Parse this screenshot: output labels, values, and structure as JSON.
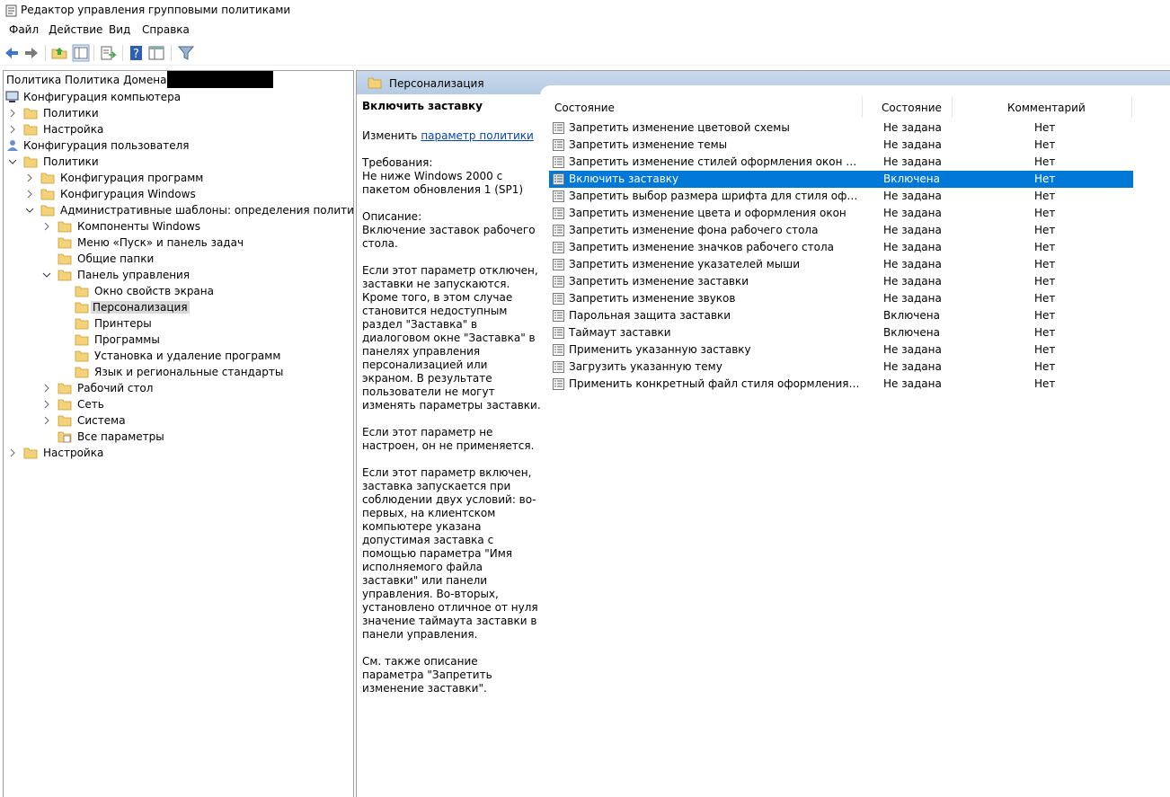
{
  "window": {
    "title": "Редактор управления групповыми политиками"
  },
  "menu": [
    "Файл",
    "Действие",
    "Вид",
    "Справка"
  ],
  "toolbar": {
    "buttons": [
      "back-arrow-icon",
      "forward-arrow-icon",
      "up-folder-icon",
      "show-hide-tree-icon",
      "export-list-icon",
      "help-icon",
      "properties-panel-icon",
      "filter-icon"
    ]
  },
  "tree": {
    "root_label": "Политика Политика Домена",
    "items": [
      {
        "label": "Конфигурация компьютера"
      },
      {
        "label": "Политики"
      },
      {
        "label": "Настройка"
      },
      {
        "label": "Конфигурация пользователя"
      },
      {
        "label": "Политики"
      },
      {
        "label": "Конфигурация программ"
      },
      {
        "label": "Конфигурация Windows"
      },
      {
        "label": "Административные шаблоны: определения политик (ADM"
      },
      {
        "label": "Компоненты Windows"
      },
      {
        "label": "Меню «Пуск» и панель задач"
      },
      {
        "label": "Общие папки"
      },
      {
        "label": "Панель управления"
      },
      {
        "label": "Окно свойств экрана"
      },
      {
        "label": "Персонализация"
      },
      {
        "label": "Принтеры"
      },
      {
        "label": "Программы"
      },
      {
        "label": "Установка и удаление программ"
      },
      {
        "label": "Язык и региональные стандарты"
      },
      {
        "label": "Рабочий стол"
      },
      {
        "label": "Сеть"
      },
      {
        "label": "Система"
      },
      {
        "label": "Все параметры"
      },
      {
        "label": "Настройка"
      }
    ]
  },
  "section": {
    "title": "Персонализация"
  },
  "description": {
    "heading": "Включить заставку",
    "edit_prefix": "Изменить ",
    "edit_link": "параметр политики",
    "requirements": "Требования:\nНе ниже Windows 2000 с пакетом обновления 1 (SP1)",
    "description": "Описание:\nВключение заставок рабочего стола.",
    "p1": "Если этот параметр отключен, заставки не запускаются. Кроме того, в этом случае становится недоступным раздел \"Заставка\" в диалоговом окне \"Заставка\" в панелях управления персонализацией или экраном. В результате пользователи не могут изменять параметры заставки.",
    "p2": "Если этот параметр не настроен, он не применяется.",
    "p3": "Если этот параметр включен, заставка запускается при соблюдении двух условий: во-первых, на клиентском компьютере указана допустимая заставка с помощью параметра \"Имя исполняемого файла заставки\" или панели управления. Во-вторых, установлено отличное от нуля значение таймаута заставки в панели управления.",
    "p4": "См. также описание параметра \"Запретить изменение заставки\"."
  },
  "list": {
    "columns": [
      "Состояние",
      "Состояние",
      "Комментарий"
    ],
    "rows": [
      {
        "name": "Запретить изменение цветовой схемы",
        "state": "Не задана",
        "comment": "Нет"
      },
      {
        "name": "Запретить изменение темы",
        "state": "Не задана",
        "comment": "Нет"
      },
      {
        "name": "Запретить изменение стилей оформления окон и кнопок",
        "state": "Не задана",
        "comment": "Нет"
      },
      {
        "name": "Включить заставку",
        "state": "Включена",
        "comment": "Нет",
        "selected": true
      },
      {
        "name": "Запретить выбор размера шрифта для стиля оформления",
        "state": "Не задана",
        "comment": "Нет"
      },
      {
        "name": "Запретить изменение цвета и оформления окон",
        "state": "Не задана",
        "comment": "Нет"
      },
      {
        "name": "Запретить изменение фона рабочего стола",
        "state": "Не задана",
        "comment": "Нет"
      },
      {
        "name": "Запретить изменение значков рабочего стола",
        "state": "Не задана",
        "comment": "Нет"
      },
      {
        "name": "Запретить изменение указателей мыши",
        "state": "Не задана",
        "comment": "Нет"
      },
      {
        "name": "Запретить изменение заставки",
        "state": "Не задана",
        "comment": "Нет"
      },
      {
        "name": "Запретить изменение звуков",
        "state": "Не задана",
        "comment": "Нет"
      },
      {
        "name": "Парольная защита заставки",
        "state": "Включена",
        "comment": "Нет"
      },
      {
        "name": "Таймаут заставки",
        "state": "Включена",
        "comment": "Нет"
      },
      {
        "name": "Применить указанную заставку",
        "state": "Не задана",
        "comment": "Нет"
      },
      {
        "name": "Загрузить указанную тему",
        "state": "Не задана",
        "comment": "Нет"
      },
      {
        "name": "Применить конкретный файл стиля оформления или кл...",
        "state": "Не задана",
        "comment": "Нет"
      }
    ]
  },
  "colors": {
    "selection": "#0078d7",
    "header_band": "#bcd0e6",
    "folder": "#f4d27a"
  }
}
